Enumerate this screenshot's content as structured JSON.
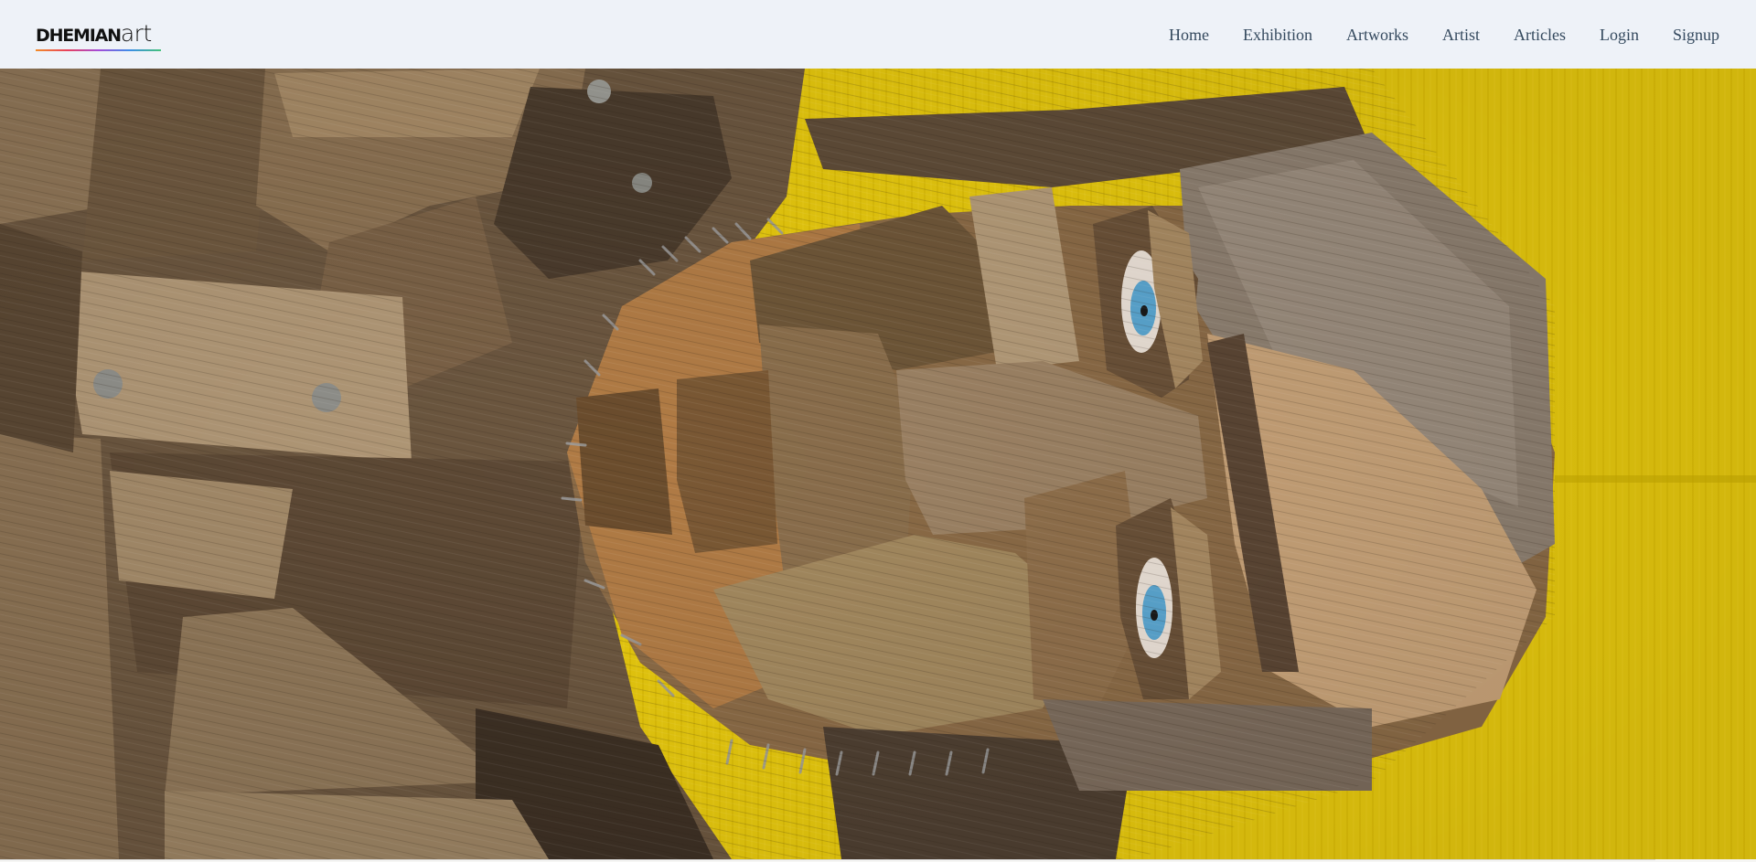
{
  "brand": {
    "name_bold": "DHEMIAN",
    "name_thin": "art"
  },
  "nav": {
    "items": [
      {
        "label": "Home"
      },
      {
        "label": "Exhibition"
      },
      {
        "label": "Artworks"
      },
      {
        "label": "Artist"
      },
      {
        "label": "Articles"
      },
      {
        "label": "Login"
      },
      {
        "label": "Signup"
      }
    ]
  },
  "hero": {
    "subject": "reclaimed-wood face sculpture on yellow background",
    "colors": {
      "background": "#e8c90f",
      "wood_dark": "#4a3a2a",
      "wood_mid": "#7a6248",
      "wood_light": "#a8906e",
      "eye_iris": "#5aa5cf"
    }
  },
  "colors": {
    "navbar_bg": "#eef2f8",
    "nav_text": "#34495e"
  }
}
